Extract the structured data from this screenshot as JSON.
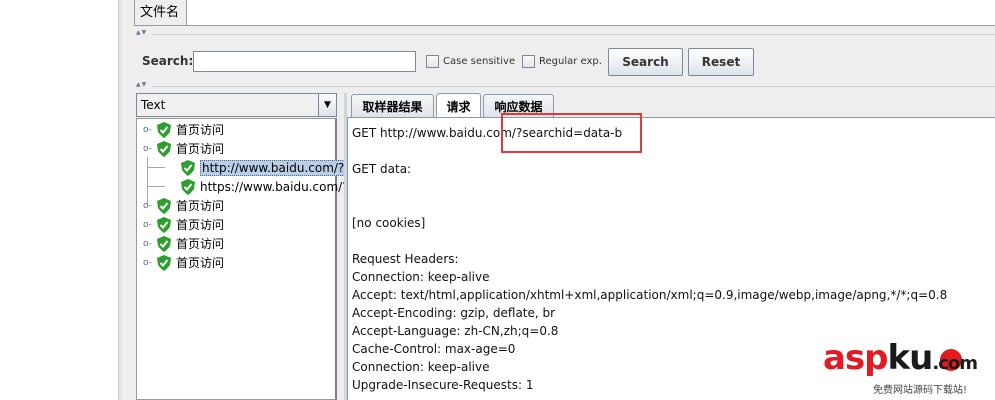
{
  "file_table": {
    "header": "文件名"
  },
  "search_bar": {
    "label": "Search:",
    "input_value": "",
    "case_sensitive_label": "Case sensitive",
    "regular_exp_label": "Regular exp.",
    "search_button": "Search",
    "reset_button": "Reset"
  },
  "renderer_combo": {
    "value": "Text"
  },
  "tree": {
    "nodes": [
      {
        "label": "首页访问",
        "expanded": false
      },
      {
        "label": "首页访问",
        "expanded": true
      },
      {
        "label": "http://www.baidu.com/?s",
        "selected": true
      },
      {
        "label": "https://www.baidu.com/?"
      },
      {
        "label": "首页访问",
        "expanded": false
      },
      {
        "label": "首页访问",
        "expanded": false
      },
      {
        "label": "首页访问",
        "expanded": false
      },
      {
        "label": "首页访问",
        "expanded": false
      }
    ]
  },
  "tabs": [
    {
      "label": "取样器结果",
      "active": false
    },
    {
      "label": "请求",
      "active": true
    },
    {
      "label": "响应数据",
      "active": false
    }
  ],
  "request": {
    "lines": [
      "GET http://www.baidu.com/?searchid=data-b",
      "GET data:",
      "[no cookies]",
      "Request Headers:",
      "Connection: keep-alive",
      "Accept: text/html,application/xhtml+xml,application/xml;q=0.9,image/webp,image/apng,*/*;q=0.8",
      "Accept-Encoding: gzip, deflate, br",
      "Accept-Language: zh-CN,zh;q=0.8",
      "Cache-Control: max-age=0",
      "Connection: keep-alive",
      "Upgrade-Insecure-Requests: 1"
    ]
  },
  "watermark": {
    "asp": "asp",
    "ku": "ku",
    "com": ".com",
    "subtitle": "免费网站源码下载站!"
  },
  "colors": {
    "highlight_box": "#e23a3a",
    "shield_green": "#2e9e2e",
    "selection": "#b8cfe5",
    "watermark_red": "#e01b22"
  }
}
